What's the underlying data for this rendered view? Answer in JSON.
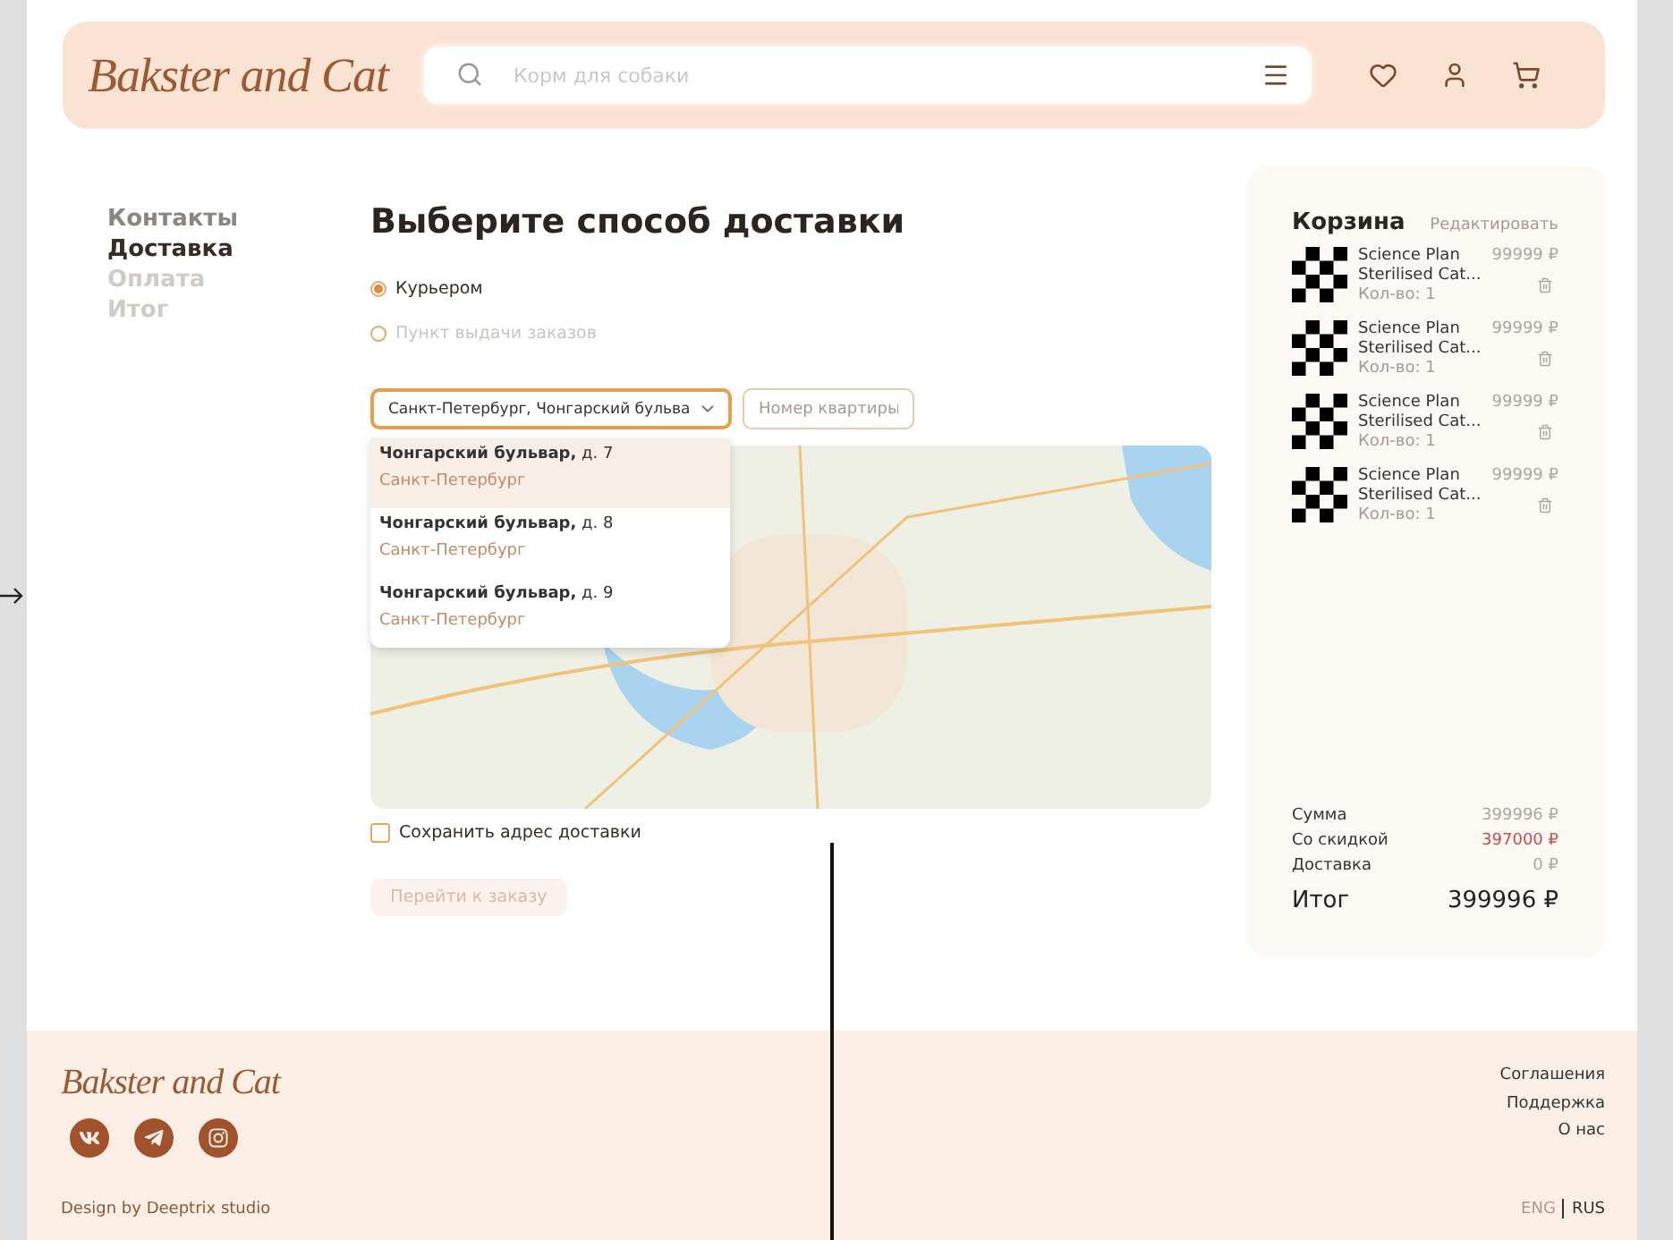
{
  "header": {
    "logo": "Bakster and Cat",
    "search": {
      "placeholder": "Корм для собаки"
    }
  },
  "steps": [
    {
      "label": "Контакты",
      "selected": false,
      "completed": true
    },
    {
      "label": "Доставка",
      "selected": true,
      "completed": false
    },
    {
      "label": "Оплата",
      "selected": false,
      "completed": false
    },
    {
      "label": "Итог",
      "selected": false,
      "completed": false
    }
  ],
  "delivery": {
    "title": "Выберите способ доставки",
    "methods": [
      {
        "label": "Курьером",
        "selected": true,
        "disabled": false
      },
      {
        "label": "Пункт выдачи заказов",
        "selected": false,
        "disabled": true
      }
    ],
    "address": {
      "value": "Санкт-Петербург, Чонгарский бульва",
      "expanded": true
    },
    "apartment": {
      "placeholder": "Номер квартиры"
    },
    "suggestions": [
      {
        "street": "**Чонгарский бульвар,** д. 7",
        "city": "Санкт-Петербург",
        "selected": true
      },
      {
        "street": "**Чонгарский бульвар,** д. 8",
        "city": "Санкт-Петербург",
        "selected": false
      },
      {
        "street": "**Чонгарский бульвар,** д. 9",
        "city": "Санкт-Петербург",
        "selected": false
      }
    ],
    "save_address": {
      "label": "Сохранить адрес доставки",
      "checked": false
    },
    "submit": {
      "label": "Перейти к заказу",
      "disabled": true
    }
  },
  "cart": {
    "title": "Корзина",
    "edit": "Редактировать",
    "items": [
      {
        "name": "Science Plan",
        "subtitle": "Sterilised Cat...",
        "quantity": "Кол-во: 1",
        "price": "99999 ₽"
      },
      {
        "name": "Science Plan",
        "subtitle": "Sterilised Cat...",
        "quantity": "Кол-во: 1",
        "price": "99999 ₽"
      },
      {
        "name": "Science Plan",
        "subtitle": "Sterilised Cat...",
        "quantity": "Кол-во: 1",
        "price": "99999 ₽"
      },
      {
        "name": "Science Plan",
        "subtitle": "Sterilised Cat...",
        "quantity": "Кол-во: 1",
        "price": "99999 ₽"
      }
    ],
    "summary": [
      {
        "label": "Сумма",
        "value": "399996 ₽",
        "kind": "plain"
      },
      {
        "label": "Со скидкой",
        "value": "397000 ₽",
        "kind": "discount"
      },
      {
        "label": "Доставка",
        "value": "0 ₽",
        "kind": "plain"
      }
    ],
    "total": {
      "label": "Итог",
      "value": "399996 ₽"
    }
  },
  "footer": {
    "logo": "Bakster and Cat",
    "credit": "Design by Deeptrix studio",
    "links": [
      "Соглашения",
      "Поддержка",
      "О нас"
    ],
    "languages": [
      {
        "label": "ENG",
        "selected": false
      },
      {
        "label": "RUS",
        "selected": true
      }
    ]
  }
}
